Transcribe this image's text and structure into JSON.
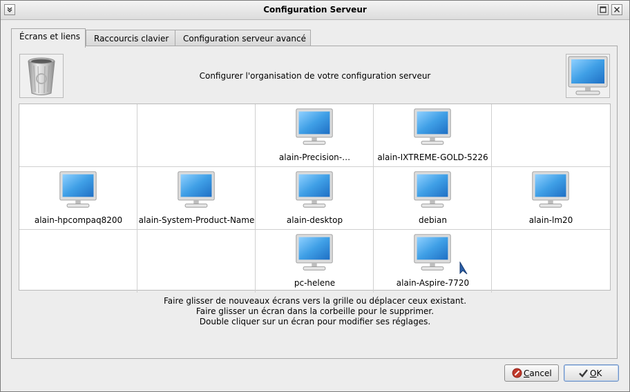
{
  "window": {
    "title": "Configuration Serveur"
  },
  "tabs": [
    {
      "label": "Écrans et liens",
      "active": true
    },
    {
      "label": "Raccourcis clavier",
      "active": false
    },
    {
      "label": "Configuration serveur avancé",
      "active": false
    }
  ],
  "header": {
    "text": "Configurer l'organisation de votre configuration serveur"
  },
  "trash": {
    "icon": "trash-icon"
  },
  "new_screen": {
    "icon": "monitor-icon"
  },
  "grid": {
    "rows": 3,
    "cols": 5,
    "cells": [
      [
        null,
        null,
        "alain-Precision-…",
        "alain-IXTREME-GOLD-5226",
        null
      ],
      [
        "alain-hpcompaq8200",
        "alain-System-Product-Name",
        "alain-desktop",
        "debian",
        "alain-lm20"
      ],
      [
        null,
        null,
        "pc-helene",
        "alain-Aspire-7720",
        null
      ]
    ]
  },
  "help": [
    "Faire glisser de nouveaux écrans vers la grille ou déplacer ceux existant.",
    "Faire glisser un écran dans la corbeille pour le supprimer.",
    "Double cliquer sur un écran pour modifier ses réglages."
  ],
  "buttons": {
    "cancel": {
      "mnemonic": "C",
      "rest": "ancel"
    },
    "ok": {
      "mnemonic": "O",
      "rest": "K"
    }
  },
  "colors": {
    "screen": "#3f9fe6",
    "ok_border": "#6b8fc4",
    "cancel_icon": "#c0392b"
  }
}
